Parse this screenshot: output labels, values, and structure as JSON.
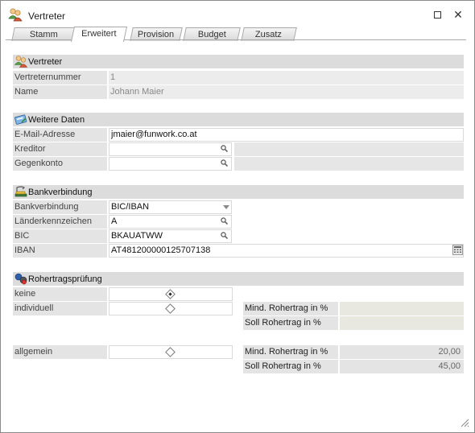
{
  "window": {
    "title": "Vertreter"
  },
  "tabs": [
    {
      "label": "Stamm"
    },
    {
      "label": "Erweitert"
    },
    {
      "label": "Provision"
    },
    {
      "label": "Budget"
    },
    {
      "label": "Zusatz"
    }
  ],
  "vertreter": {
    "header": "Vertreter",
    "nummer_label": "Vertreternummer",
    "nummer_value": "1",
    "name_label": "Name",
    "name_value": "Johann Maier"
  },
  "weitere": {
    "header": "Weitere Daten",
    "email_label": "E-Mail-Adresse",
    "email_value": "jmaier@funwork.co.at",
    "kreditor_label": "Kreditor",
    "kreditor_value": "",
    "gegenkonto_label": "Gegenkonto",
    "gegenkonto_value": ""
  },
  "bank": {
    "header": "Bankverbindung",
    "bankverbindung_label": "Bankverbindung",
    "bankverbindung_value": "BIC/IBAN",
    "laender_label": "Länderkennzeichen",
    "laender_value": "A",
    "bic_label": "BIC",
    "bic_value": "BKAUATWW",
    "iban_label": "IBAN",
    "iban_value": "AT481200000125707138"
  },
  "rohertrag": {
    "header": "Rohertragsprüfung",
    "keine_label": "keine",
    "individuell_label": "individuell",
    "allgemein_label": "allgemein",
    "selected": "keine",
    "mind_label": "Mind. Rohertrag in %",
    "soll_label": "Soll Rohertrag in %",
    "ind_mind_value": "",
    "ind_soll_value": "",
    "allg_mind_value": "20,00",
    "allg_soll_value": "45,00"
  }
}
